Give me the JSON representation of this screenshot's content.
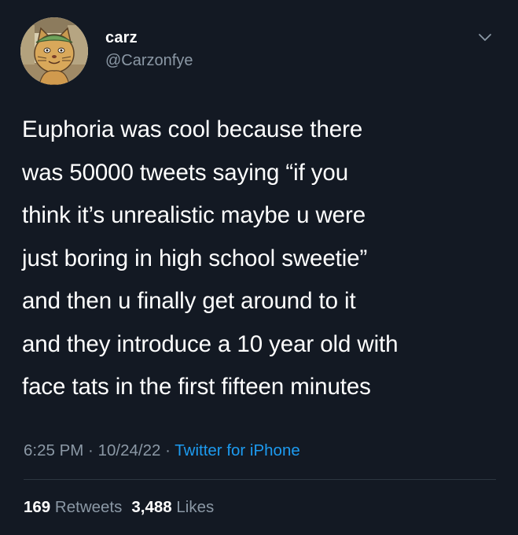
{
  "author": {
    "display_name": "carz",
    "handle": "@Carzonfye"
  },
  "tweet": {
    "text": "Euphoria was cool because there\nwas 50000 tweets saying “if you\nthink it’s unrealistic maybe u were\njust boring in high school sweetie”\nand then u finally get around to it\nand they introduce a 10 year old with\nface tats in the first fifteen minutes",
    "time": "6:25 PM",
    "date": "10/24/22",
    "separator": " · ",
    "source": "Twitter for iPhone"
  },
  "stats": {
    "retweets_count": "169",
    "retweets_label": "Retweets",
    "likes_count": "3,488",
    "likes_label": "Likes"
  },
  "icons": {
    "menu": "chevron-down-icon",
    "avatar": "cartoon-cat-avatar"
  },
  "colors": {
    "background": "#131923",
    "primary_text": "#ffffff",
    "secondary_text": "#8b98a5",
    "link": "#1d9bf0",
    "divider": "#2c3640"
  }
}
